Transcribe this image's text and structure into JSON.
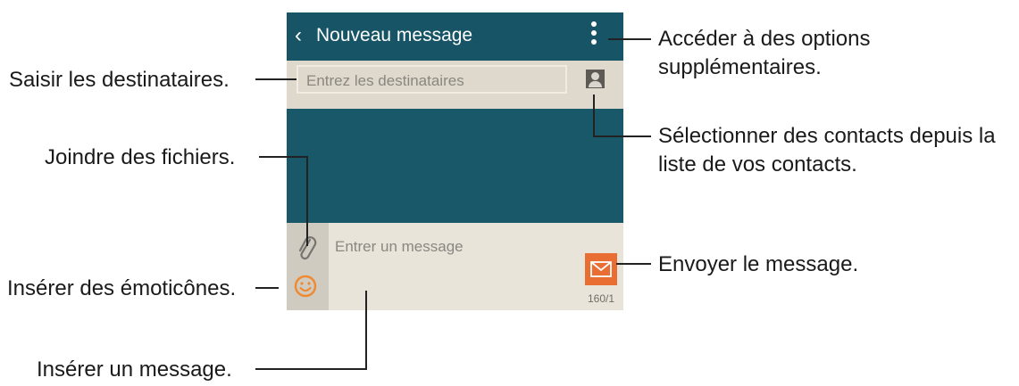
{
  "app": {
    "back_glyph": "‹",
    "title": "Nouveau message",
    "recipients_placeholder": "Entrez les destinataires",
    "message_placeholder": "Entrer un message",
    "counter": "160/1"
  },
  "colors": {
    "app_bar": "#175566",
    "background": "#195868",
    "input_bar": "#ded9cc",
    "send_button": "#e86e33",
    "emoji": "#f08a32"
  },
  "icons": [
    "back-icon",
    "more-options-icon",
    "contact-icon",
    "paperclip-icon",
    "emoji-icon",
    "send-icon"
  ],
  "callouts": {
    "recipients": "Saisir les destinataires.",
    "attach": "Joindre des fichiers.",
    "emoticons": "Insérer des émoticônes.",
    "message": "Insérer un message.",
    "options_line1": "Accéder à des options",
    "options_line2": "supplémentaires.",
    "contacts_line1": "Sélectionner des contacts depuis la",
    "contacts_line2": "liste de vos contacts.",
    "send": "Envoyer le message."
  }
}
